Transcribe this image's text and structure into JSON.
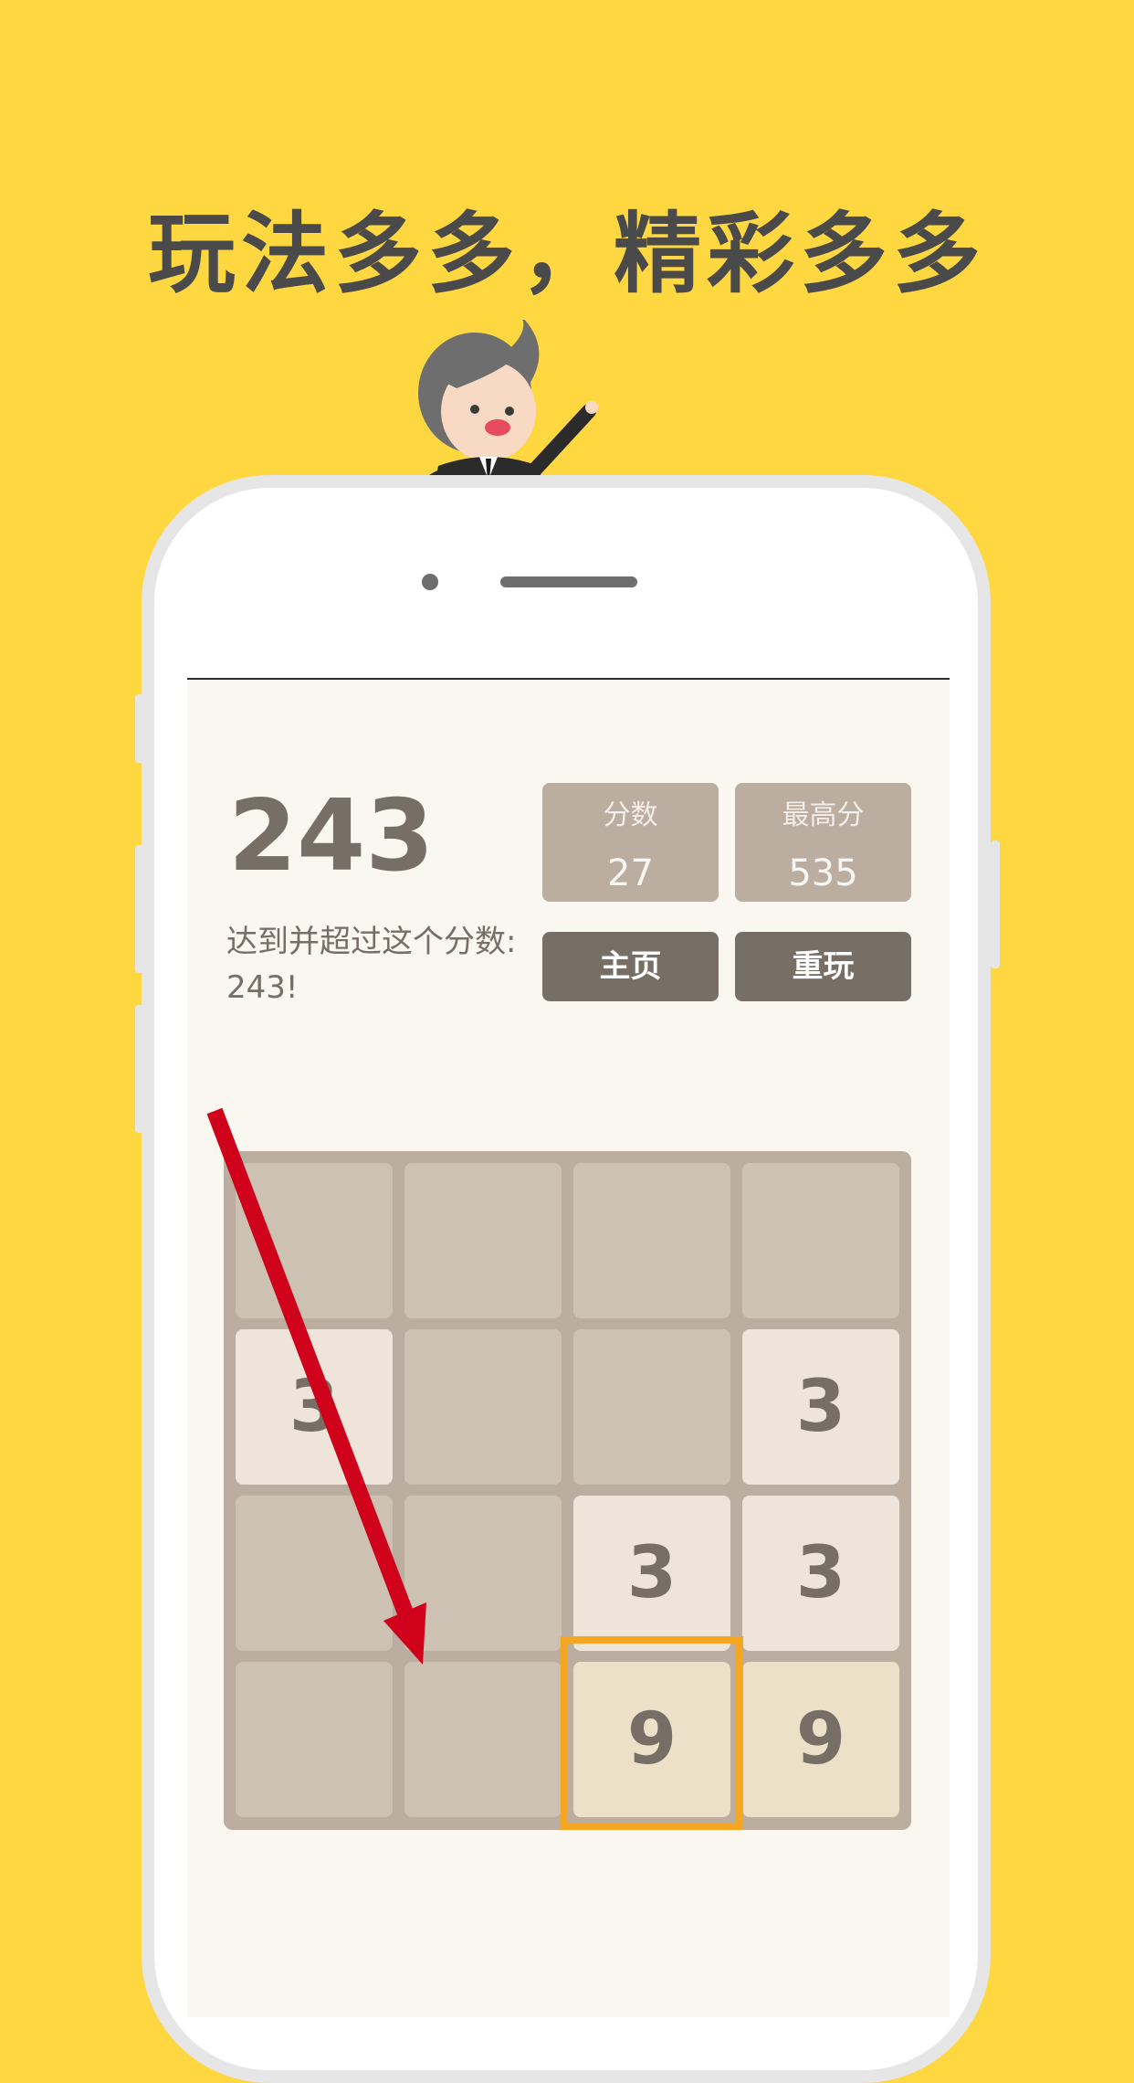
{
  "headline": "玩法多多，精彩多多",
  "game": {
    "target_value": "243",
    "goal_text": "达到并超过这个分数: 243!",
    "score": {
      "label": "分数",
      "value": "27"
    },
    "best": {
      "label": "最高分",
      "value": "535"
    },
    "home_button": "主页",
    "restart_button": "重玩",
    "grid": [
      [
        "",
        "",
        "",
        ""
      ],
      [
        "3",
        "",
        "",
        "3"
      ],
      [
        "",
        "",
        "3",
        "3"
      ],
      [
        "",
        "",
        "9",
        "9"
      ]
    ],
    "highlighted_cell": {
      "row": 3,
      "col": 2
    }
  },
  "colors": {
    "background": "#FFD740",
    "board": "#BBADA0",
    "empty_cell": "#CDC1B4",
    "tile_3": "#EEE4DA",
    "tile_9": "#EDE0C8",
    "highlight": "#F5A623",
    "arrow": "#D0021B"
  },
  "icons": {
    "mascot": "businessman-mascot-icon",
    "arrow": "swipe-arrow-icon"
  }
}
